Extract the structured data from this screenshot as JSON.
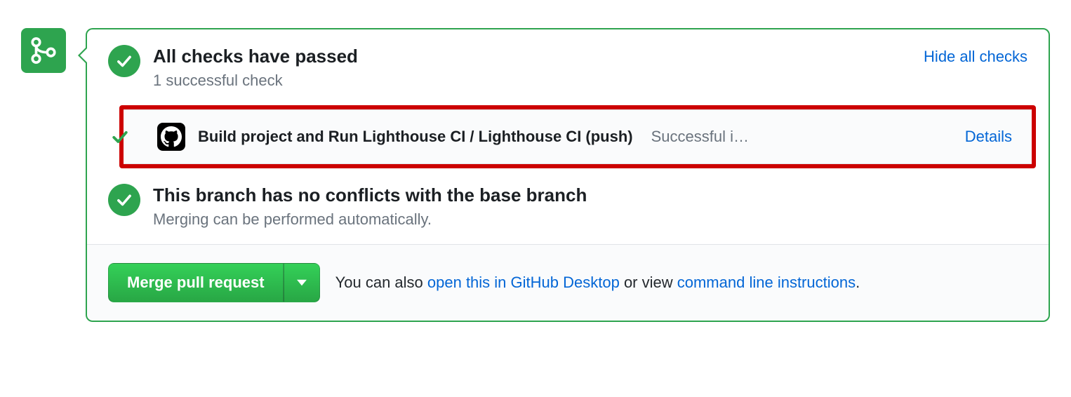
{
  "checks": {
    "title": "All checks have passed",
    "subtitle": "1 successful check",
    "toggle_label": "Hide all checks",
    "items": [
      {
        "name": "Build project and Run Lighthouse CI / Lighthouse CI (push)",
        "status": "Successful i…",
        "details_label": "Details"
      }
    ]
  },
  "conflicts": {
    "title": "This branch has no conflicts with the base branch",
    "subtitle": "Merging can be performed automatically."
  },
  "merge": {
    "button_label": "Merge pull request",
    "hint_prefix": "You can also ",
    "desktop_link": "open this in GitHub Desktop",
    "hint_mid": " or view ",
    "cli_link": "command line instructions",
    "hint_suffix": "."
  }
}
